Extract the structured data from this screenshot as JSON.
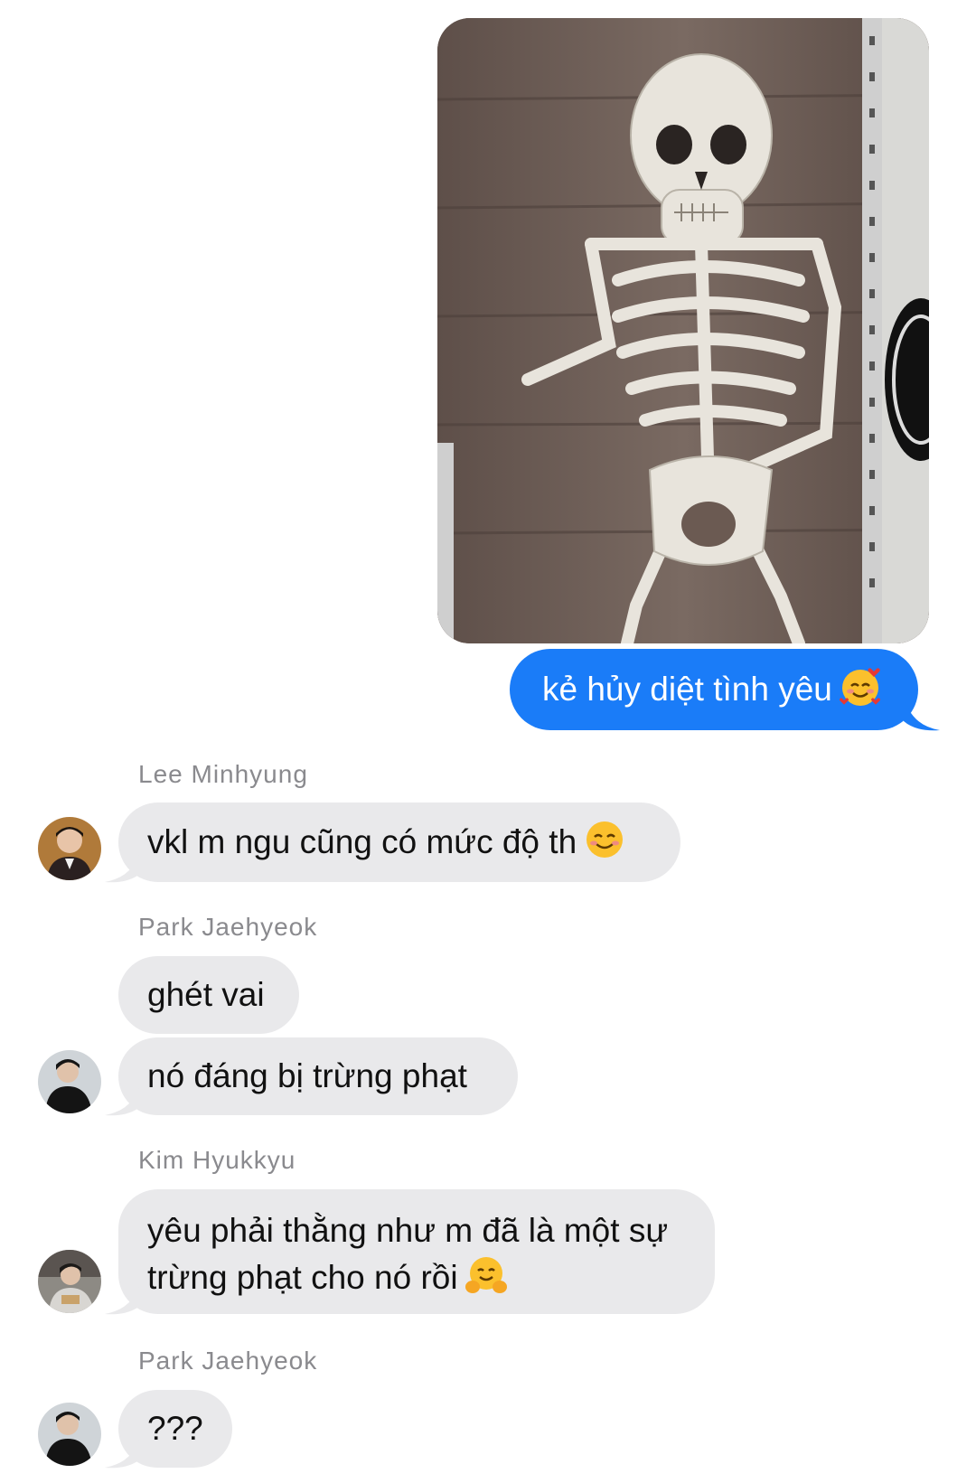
{
  "outgoing": {
    "image_alt_icon": "skeleton-photo",
    "message": "kẻ hủy diệt tình yêu",
    "emoji": "smiling-face-with-hearts"
  },
  "conversation": [
    {
      "sender": "Lee Minhyung",
      "messages": [
        {
          "text": "vkl m ngu cũng có mức độ th",
          "emoji": "smiling-face"
        }
      ]
    },
    {
      "sender": "Park Jaehyeok",
      "messages": [
        {
          "text": "ghét vai"
        },
        {
          "text": "nó đáng bị trừng phạt"
        }
      ]
    },
    {
      "sender": "Kim Hyukkyu",
      "messages": [
        {
          "line1": "yêu phải thằng như m đã là một sự",
          "line2": "trừng phạt cho nó rồi",
          "emoji": "hugging-face"
        }
      ]
    },
    {
      "sender": "Park Jaehyeok",
      "messages": [
        {
          "text": "???"
        }
      ]
    }
  ],
  "colors": {
    "outgoing_bubble": "#1a7cf8",
    "incoming_bubble": "#e9e9eb",
    "sender_name": "#8a8a8e"
  }
}
